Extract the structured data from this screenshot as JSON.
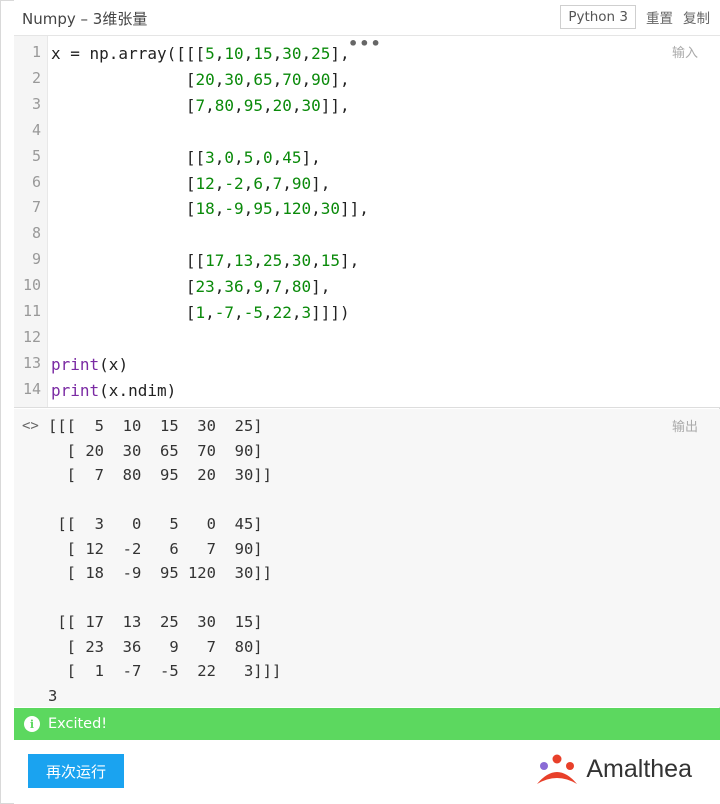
{
  "header": {
    "title": "Numpy – 3维张量",
    "language": "Python 3",
    "reset_label": "重置",
    "copy_label": "复制"
  },
  "editor": {
    "corner_label": "输入",
    "line_numbers": [
      "1",
      "2",
      "3",
      "4",
      "5",
      "6",
      "7",
      "8",
      "9",
      "10",
      "11",
      "12",
      "13",
      "14"
    ],
    "code_lines": [
      "x = np.array([[[5,10,15,30,25],",
      "              [20,30,65,70,90],",
      "              [7,80,95,20,30]],",
      "",
      "              [[3,0,5,0,45],",
      "              [12,-2,6,7,90],",
      "              [18,-9,95,120,30]],",
      "",
      "              [[17,13,25,30,15],",
      "              [23,36,9,7,80],",
      "              [1,-7,-5,22,3]]])",
      "",
      "print(x)",
      "print(x.ndim)"
    ]
  },
  "output": {
    "corner_label": "输出",
    "text": "[[[  5  10  15  30  25]\n  [ 20  30  65  70  90]\n  [  7  80  95  20  30]]\n\n [[  3   0   5   0  45]\n  [ 12  -2   6   7  90]\n  [ 18  -9  95 120  30]]\n\n [[ 17  13  25  30  15]\n  [ 23  36   9   7  80]\n  [  1  -7  -5  22   3]]]\n3"
  },
  "status": {
    "text": "Excited!",
    "color": "#5cd85f"
  },
  "footer": {
    "run_label": "再次运行",
    "brand": "Amalthea",
    "accent": "#1aa3f0"
  }
}
